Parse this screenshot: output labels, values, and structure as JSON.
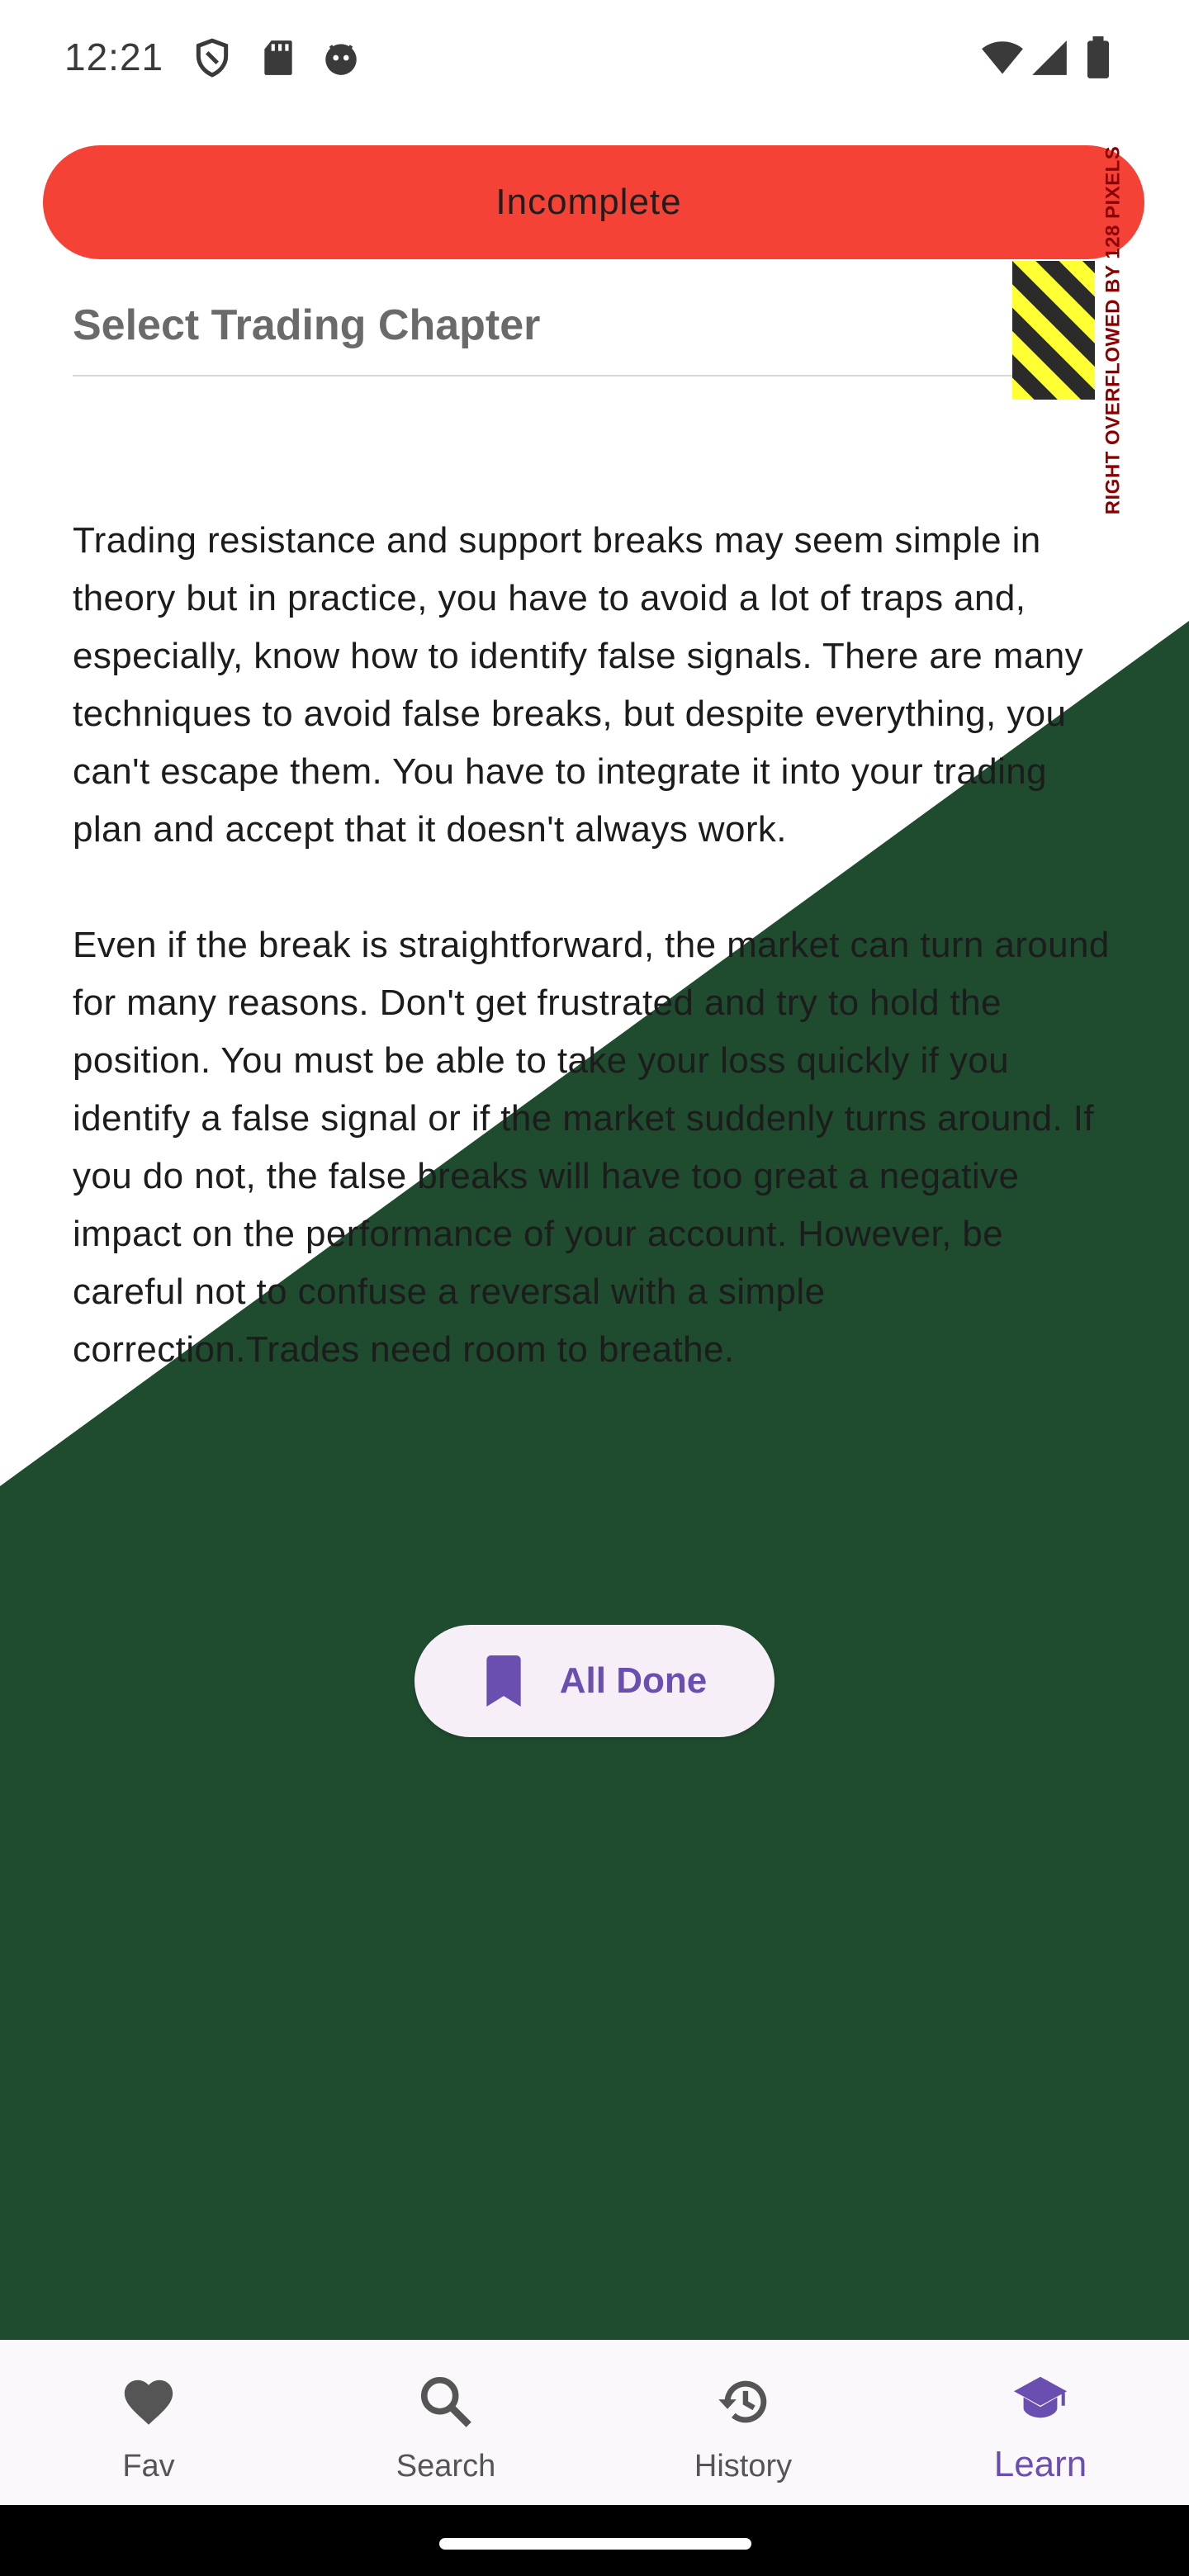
{
  "status_bar": {
    "time": "12:21",
    "left_icons": [
      "shield-icon",
      "sd-card-icon",
      "face-icon"
    ],
    "right_icons": [
      "wifi-icon",
      "signal-icon",
      "battery-icon"
    ]
  },
  "header": {
    "incomplete_label": "Incomplete",
    "overflow_warning": "RIGHT OVERFLOWED BY 128 PIXELS",
    "chapter_select_label": "Select Trading Chapter"
  },
  "content": {
    "paragraphs": [
      "Trading resistance and support breaks may seem simple in theory but in practice, you have to avoid a lot of traps and, especially, know how to identify false signals. There are many techniques to avoid false breaks, but despite everything, you can't escape them. You have to integrate it into your trading plan and accept that it doesn't always work.",
      "Even if the break is straightforward, the market can turn around for many reasons. Don't get frustrated and try to hold the position. You must be able to take your loss quickly if you identify a false signal or if the market suddenly turns around. If you do not, the false breaks will have too great a negative impact on the performance of your account. However, be careful not to confuse a reversal with a simple correction.Trades need room to breathe."
    ]
  },
  "actions": {
    "all_done_label": "All Done"
  },
  "bottom_nav": {
    "items": [
      {
        "label": "Fav",
        "icon": "heart-icon",
        "active": false
      },
      {
        "label": "Search",
        "icon": "search-icon",
        "active": false
      },
      {
        "label": "History",
        "icon": "history-icon",
        "active": false
      },
      {
        "label": "Learn",
        "icon": "graduation-cap-icon",
        "active": true
      }
    ]
  },
  "colors": {
    "accent": "#6a4fb0",
    "incomplete_bg": "#f44336",
    "background_green": "#1f4b2e",
    "overflow_stripe_yellow": "#ffff33"
  }
}
